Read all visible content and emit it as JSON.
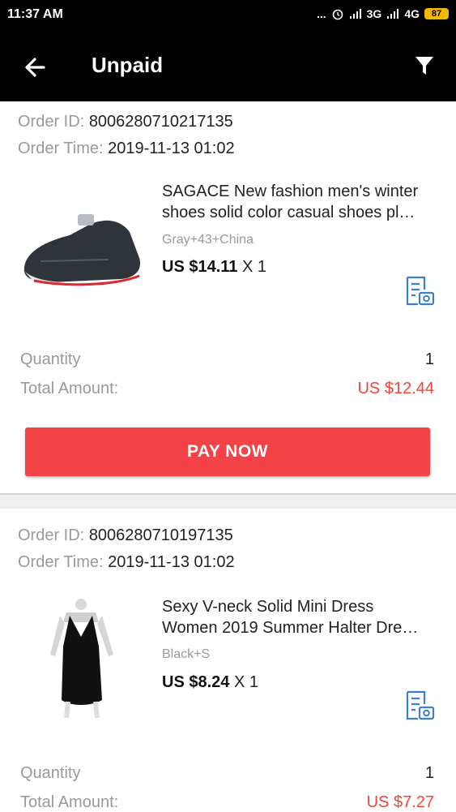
{
  "status_bar": {
    "time": "11:37 AM",
    "dots": "...",
    "network_1": "3G",
    "network_2": "4G",
    "battery": "87"
  },
  "app_bar": {
    "title": "Unpaid",
    "back_icon": "arrow-left",
    "filter_icon": "filter-funnel"
  },
  "orders": [
    {
      "order_id_label": "Order ID:",
      "order_id": "8006280710217135",
      "order_time_label": "Order Time:",
      "order_time": "2019-11-13 01:02",
      "product_title_line1": "SAGACE New fashion men's winter",
      "product_title_line2": "shoes solid color casual shoes pl…",
      "variant": "Gray+43+China",
      "price": "US $14.11",
      "qty_text": "X 1",
      "quantity_label": "Quantity",
      "quantity": "1",
      "total_label": "Total Amount:",
      "total": "US $12.44",
      "pay_label": "PAY NOW"
    },
    {
      "order_id_label": "Order ID:",
      "order_id": "8006280710197135",
      "order_time_label": "Order Time:",
      "order_time": "2019-11-13 01:02",
      "product_title_line1": "Sexy V-neck Solid Mini Dress",
      "product_title_line2": "Women 2019 Summer Halter Dre…",
      "variant": "Black+S",
      "price": "US $8.24",
      "qty_text": "X 1",
      "quantity_label": "Quantity",
      "quantity": "1",
      "total_label": "Total Amount:",
      "total": "US $7.27"
    }
  ],
  "colors": {
    "accent": "#f44346",
    "price_red": "#f44336",
    "icon_blue": "#3a7fd5"
  }
}
